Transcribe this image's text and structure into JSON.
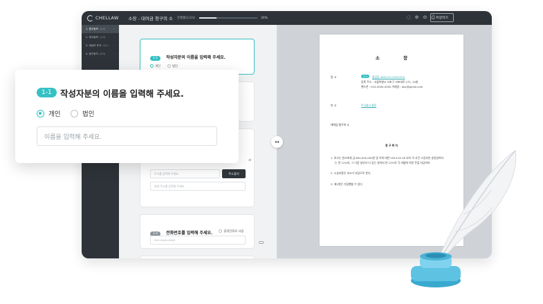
{
  "app": {
    "logo_text": "CHELLAW",
    "doc_title": "소장 - 대여금 청구의 소",
    "progress_label": "진행률(1/24)",
    "progress_fraction": 0.3,
    "progress_pct": "30%",
    "save_label": "저장하기"
  },
  "sidebar": {
    "items": [
      {
        "label": "1. 원고정보",
        "count": "(1/4)",
        "active": true
      },
      {
        "label": "2. 피고정보",
        "count": "(1/3)",
        "active": false
      },
      {
        "label": "3. 대상자 추가",
        "count": "(0/1)",
        "active": false
      },
      {
        "label": "4. 청구취지",
        "count": "(0/4)",
        "active": false
      }
    ]
  },
  "form": {
    "q1": {
      "tag": "1-1",
      "title": "작성자분의 이름을 입력해 주세요.",
      "opt1": "개인",
      "opt2": "법인"
    },
    "addr": {
      "placeholder": "주소를 입력해 주세요.",
      "button": "주소찾기",
      "detail_placeholder": "상세 주소를 입력해 주세요.",
      "side": "세"
    },
    "q4": {
      "tag": "1-4",
      "title": "전화번호를 입력해 주세요.",
      "opt": "휴대전화로 사용",
      "placeholder": "010-0000-0000"
    }
  },
  "paper": {
    "title": "소 장",
    "plaintiff_label": "원 고",
    "plaintiff_tag": "1-1",
    "plaintiff_name": "홍길동 (800123-2022333)",
    "plaintiff_addr": "등록 주소 : 서울특별시 서초구 서초대로 272, 10층",
    "plaintiff_phone": "핸드폰 : 010-0000-0000 이메일 : abc@gmail.com",
    "defendant_label": "피 고",
    "defendant_name": "주식회사 철로",
    "case_name": "대여금 청구의 소",
    "section_title": "청 구 취 지",
    "claims": [
      "1. 피고는 원고에게 금 800,000,000원 및 이에 대한 2024.02.28 부터 이 사건 소장부본 송달일까지",
      "는 연 12%의, 그 다음 날부터 다 갚는 날까지 연 12%의 각 비율에 의한 돈을 지급하라.",
      "2. 소송비용은 피고가 부담으로 한다.",
      "3. 제1항은 가집행할 수 있다."
    ]
  },
  "popup": {
    "tag": "1-1",
    "title": "작성자분의 이름을 입력해 주세요.",
    "option_individual": "개인",
    "option_corporation": "법인",
    "placeholder": "이름을 입력해 주세요."
  },
  "icons": [
    "bell-icon",
    "zoom-in-icon",
    "zoom-out-icon",
    "print-icon",
    "swap-icon",
    "document-icon",
    "quill-icon",
    "inkpot-icon"
  ],
  "colors": {
    "accent": "#36c1c4",
    "topbar": "#2d3338",
    "ink": "#4fb8d8"
  }
}
